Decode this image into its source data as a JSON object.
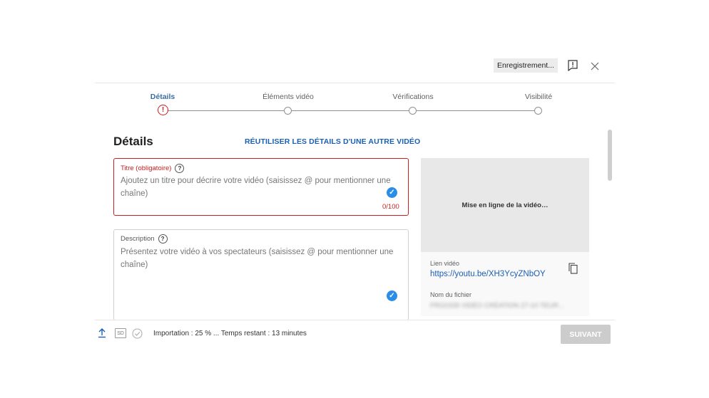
{
  "header": {
    "saving_status": "Enregistrement...",
    "feedback_icon": "feedback-flag-icon",
    "close_icon": "close-icon"
  },
  "steps": [
    {
      "label": "Détails",
      "state": "error"
    },
    {
      "label": "Éléments vidéo",
      "state": "pending"
    },
    {
      "label": "Vérifications",
      "state": "pending"
    },
    {
      "label": "Visibilité",
      "state": "pending"
    }
  ],
  "main": {
    "title": "Détails",
    "reuse_link": "RÉUTILISER LES DÉTAILS D'UNE AUTRE VIDÉO",
    "title_field": {
      "label": "Titre (obligatoire)",
      "placeholder": "Ajoutez un titre pour décrire votre vidéo (saisissez @ pour mentionner une chaîne)",
      "counter": "0/100"
    },
    "description_field": {
      "label": "Description",
      "placeholder": "Présentez votre vidéo à vos spectateurs (saisissez @ pour mentionner une chaîne)"
    }
  },
  "side_panel": {
    "preview_text": "Mise en ligne de la vidéo…",
    "video_link_label": "Lien vidéo",
    "video_link": "https://youtu.be/XH3YcyZNbOY",
    "file_name_label": "Nom du fichier",
    "file_name": "FRG0339 VIDÉO CRÉATION 27-10 TEUR..."
  },
  "footer": {
    "sd_label": "SD",
    "status": "Importation : 25 % ... Temps restant : 13 minutes",
    "next_button": "SUIVANT"
  },
  "colors": {
    "accent_blue": "#1a5fb4",
    "error_red": "#cc1e1e",
    "check_blue": "#2a8ee8"
  }
}
